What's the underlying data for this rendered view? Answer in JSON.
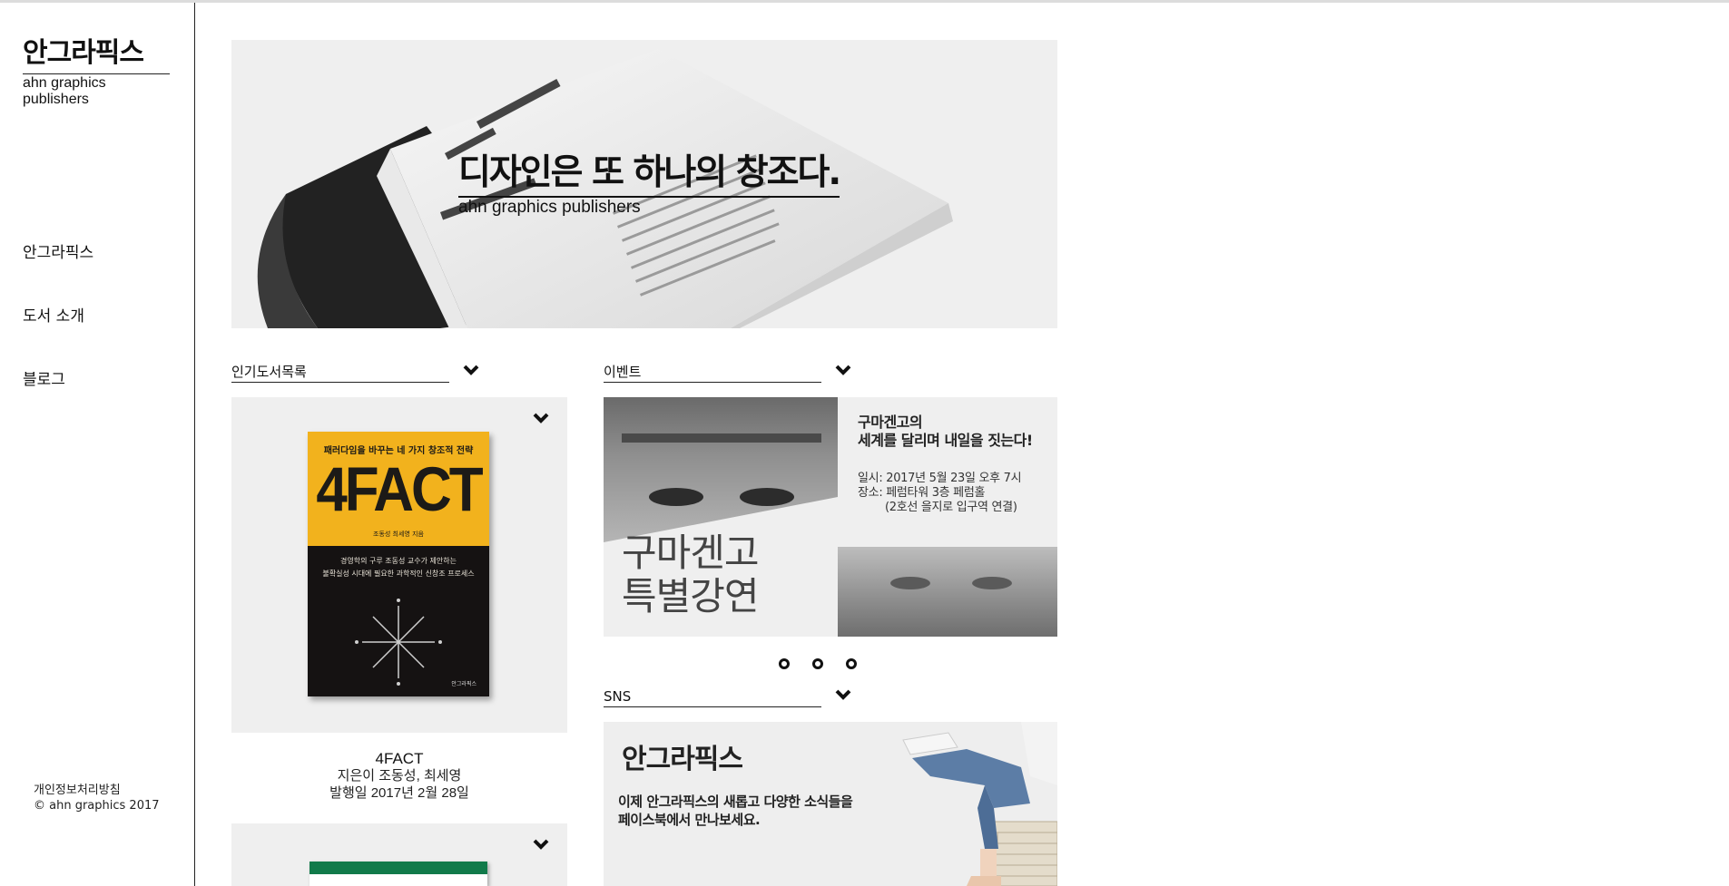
{
  "brand": {
    "logo_kr": "안그라픽스",
    "logo_en": "ahn graphics publishers"
  },
  "nav": {
    "items": [
      {
        "label": "안그라픽스"
      },
      {
        "label": "도서 소개"
      },
      {
        "label": "블로그"
      }
    ]
  },
  "footer": {
    "privacy": "개인정보처리방침",
    "copyright": "© ahn graphics 2017"
  },
  "hero": {
    "title": "디자인은 또 하나의 창조다.",
    "subtitle": "ahn graphics publishers"
  },
  "sections": {
    "popular": "인기도서목록",
    "event": "이벤트",
    "sns": "SNS"
  },
  "featured_book": {
    "cover_tagline": "패러다임을 바꾸는 네 가지 창조적 전략",
    "cover_title": "4FACT",
    "cover_authors": "조동성 최세영 지음",
    "cover_desc_1": "경영학의 구루 조동성 교수가 제안하는",
    "cover_desc_2": "불확실성 시대에 필요한 과학적인 신창조 프로세스",
    "cover_publisher": "안그라픽스",
    "title": "4FACT",
    "authors": "지은이 조동성, 최세영",
    "date": "발행일 2017년 2월 28일"
  },
  "event": {
    "big_line1": "구마겐고",
    "big_line2": "특별강연",
    "head_line1": "구마겐고의",
    "head_line2": "세계를 달리며 내일을 짓는다!",
    "when": "일시: 2017년 5월 23일 오후 7시",
    "where": "장소: 페럼타워 3층 페럼홀",
    "where_detail": "(2호선 을지로 입구역 연결)"
  },
  "sns": {
    "logo": "안그라픽스",
    "line1": "이제 안그라픽스의 새롭고 다양한 소식들을",
    "line2": "페이스북에서 만나보세요."
  },
  "icons": {
    "chevron": "chevron-down-icon",
    "dot": "carousel-dot"
  }
}
